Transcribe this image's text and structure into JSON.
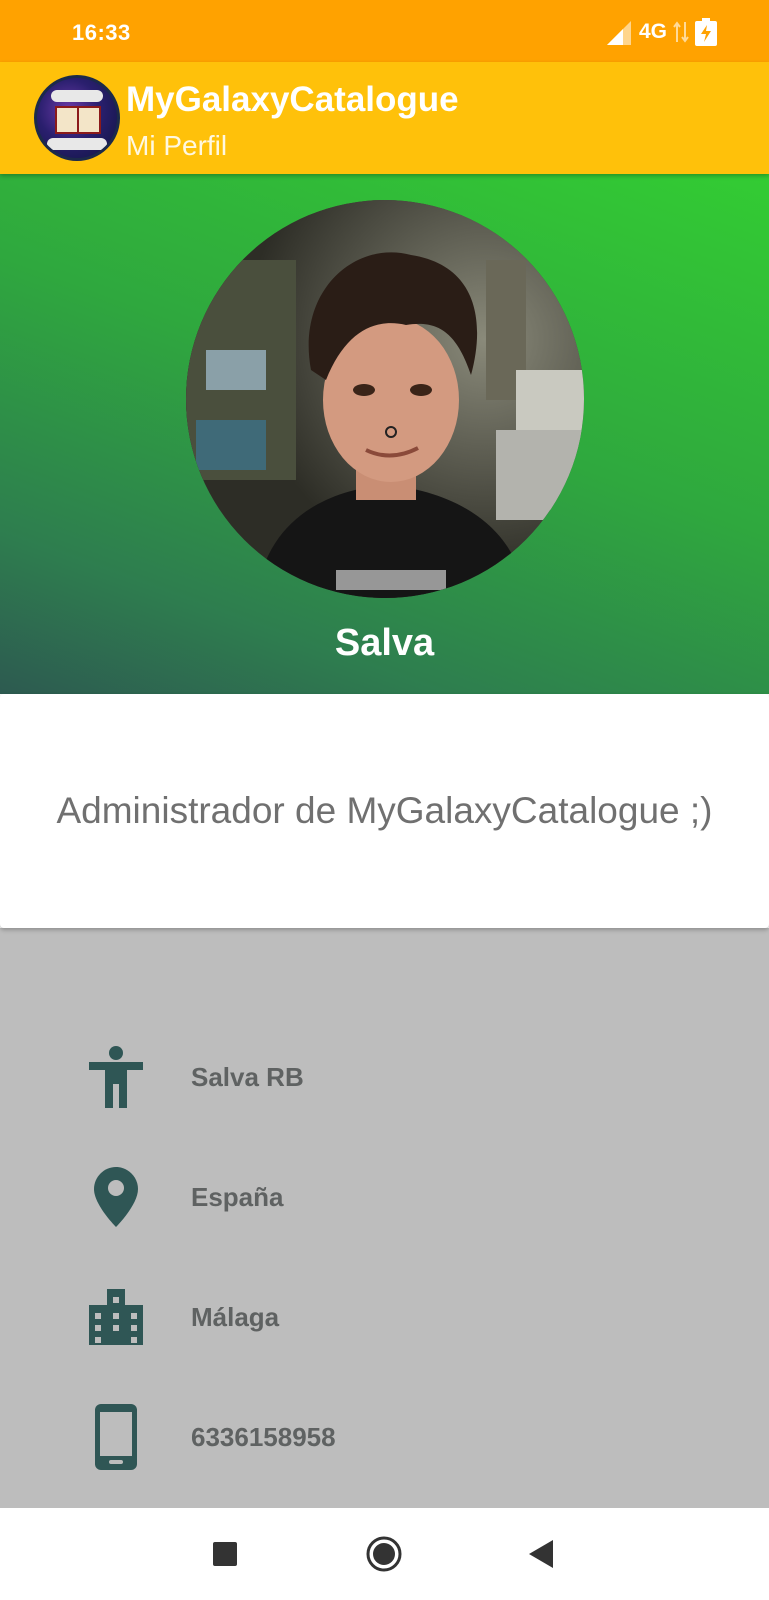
{
  "status_bar": {
    "time": "16:33",
    "network": "4G",
    "icons": [
      "signal-icon",
      "data-arrows-icon",
      "battery-charging-icon"
    ]
  },
  "app_bar": {
    "logo": "app-logo",
    "title": "MyGalaxyCatalogue",
    "subtitle": "Mi Perfil"
  },
  "profile": {
    "name": "Salva",
    "bio": "Administrador de MyGalaxyCatalogue ;)"
  },
  "details": [
    {
      "icon": "person-icon",
      "value": "Salva RB"
    },
    {
      "icon": "location-pin-icon",
      "value": "España"
    },
    {
      "icon": "city-icon",
      "value": "Málaga"
    },
    {
      "icon": "phone-icon",
      "value": "6336158958"
    }
  ],
  "nav_bar": {
    "buttons": [
      "recents-icon",
      "home-icon",
      "back-icon"
    ]
  },
  "colors": {
    "status_bar": "#FFA200",
    "app_bar": "#FFC10A",
    "header_green": "#33CC33",
    "details_bg": "#BDBDBD",
    "icon_color": "#2F5655"
  }
}
